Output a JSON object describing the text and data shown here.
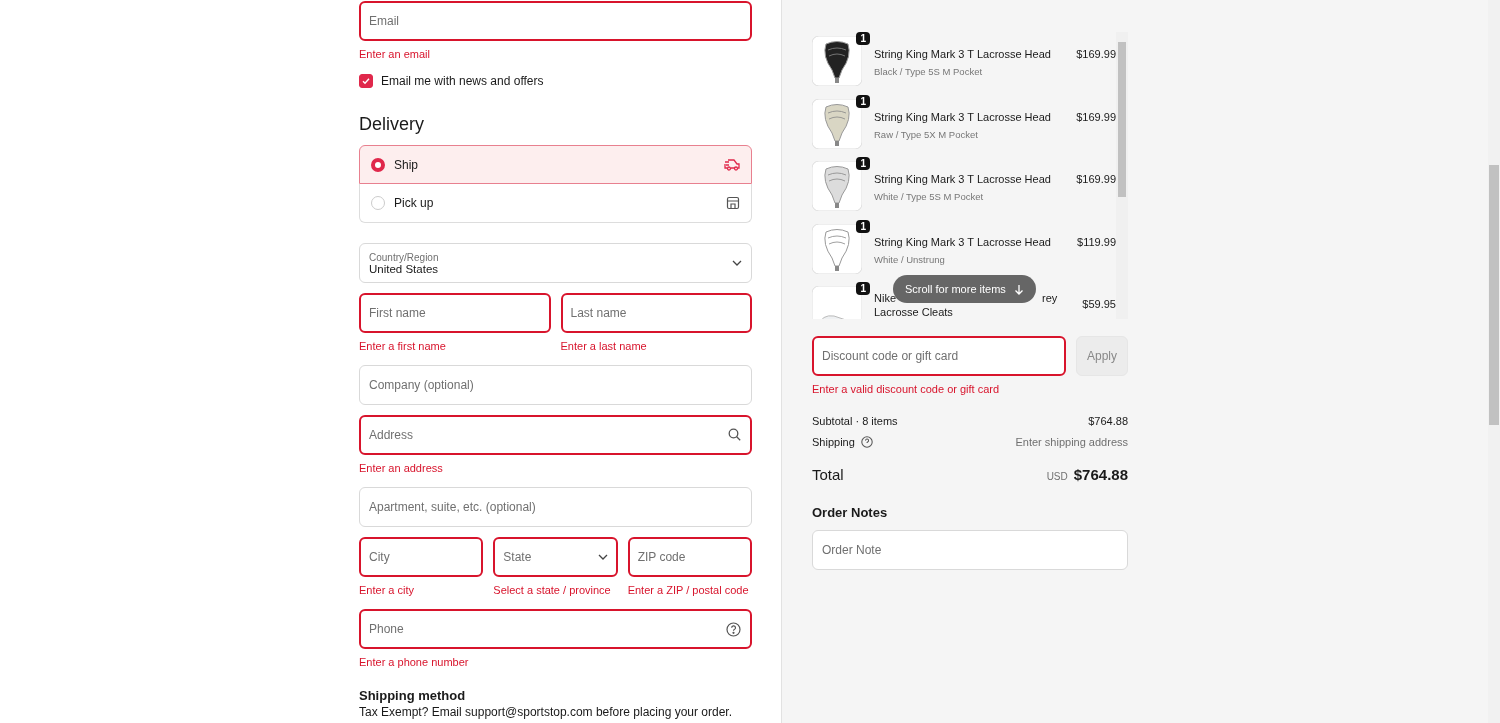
{
  "contact": {
    "email": {
      "placeholder": "Email",
      "error": "Enter an email"
    },
    "newsletter": {
      "label": "Email me with news and offers",
      "checked": true
    }
  },
  "delivery": {
    "title": "Delivery",
    "options": [
      {
        "label": "Ship",
        "kind": "ship",
        "selected": true
      },
      {
        "label": "Pick up",
        "kind": "pickup",
        "selected": false
      }
    ]
  },
  "address_rows": [
    [
      {
        "kind": "country",
        "label": "Country/Region",
        "value": "United States"
      }
    ],
    [
      {
        "kind": "text",
        "placeholder": "First name",
        "error": "Enter a first name"
      },
      {
        "kind": "text",
        "placeholder": "Last name",
        "error": "Enter a last name"
      }
    ],
    [
      {
        "kind": "text",
        "placeholder": "Company (optional)"
      }
    ],
    [
      {
        "kind": "search",
        "placeholder": "Address",
        "error": "Enter an address"
      }
    ],
    [
      {
        "kind": "text",
        "placeholder": "Apartment, suite, etc. (optional)"
      }
    ],
    [
      {
        "kind": "text",
        "placeholder": "City",
        "error": "Enter a city"
      },
      {
        "kind": "select",
        "placeholder": "State",
        "error": "Select a state / province"
      },
      {
        "kind": "text",
        "placeholder": "ZIP code",
        "error": "Enter a ZIP / postal code"
      }
    ],
    [
      {
        "kind": "help",
        "placeholder": "Phone",
        "error": "Enter a phone number"
      }
    ]
  ],
  "shipping_method": {
    "title": "Shipping method",
    "note": "Tax Exempt? Email support@sportstop.com before placing your order."
  },
  "order": {
    "items": [
      {
        "kind": "head-black",
        "quantity": "1",
        "name": "String King Mark 3 T Lacrosse Head",
        "variant": "Black / Type 5S M Pocket",
        "price": "$169.99"
      },
      {
        "kind": "head-raw",
        "quantity": "1",
        "name": "String King Mark 3 T Lacrosse Head",
        "variant": "Raw / Type 5X M Pocket",
        "price": "$169.99"
      },
      {
        "kind": "head-white",
        "quantity": "1",
        "name": "String King Mark 3 T Lacrosse Head",
        "variant": "White / Type 5S M Pocket",
        "price": "$169.99"
      },
      {
        "kind": "head-unstrung",
        "quantity": "1",
        "name": "String King Mark 3 T Lacrosse Head",
        "variant": "White / Unstrung",
        "price": "$119.99"
      },
      {
        "kind": "shoe",
        "quantity": "1",
        "name": "Nike",
        "name_end": "rey",
        "name_line2": "Lacrosse Cleats",
        "price": "$59.95"
      }
    ],
    "scroll_hint": "Scroll for more items",
    "discount": {
      "placeholder": "Discount code or gift card",
      "button": "Apply",
      "error": "Enter a valid discount code or gift card"
    },
    "subtotal": {
      "label": "Subtotal · 8 items",
      "value": "$764.88"
    },
    "shipping": {
      "label": "Shipping",
      "value": "Enter shipping address"
    },
    "total": {
      "label": "Total",
      "currency": "USD",
      "value": "$764.88"
    },
    "notes": {
      "title": "Order Notes",
      "placeholder": "Order Note"
    }
  }
}
